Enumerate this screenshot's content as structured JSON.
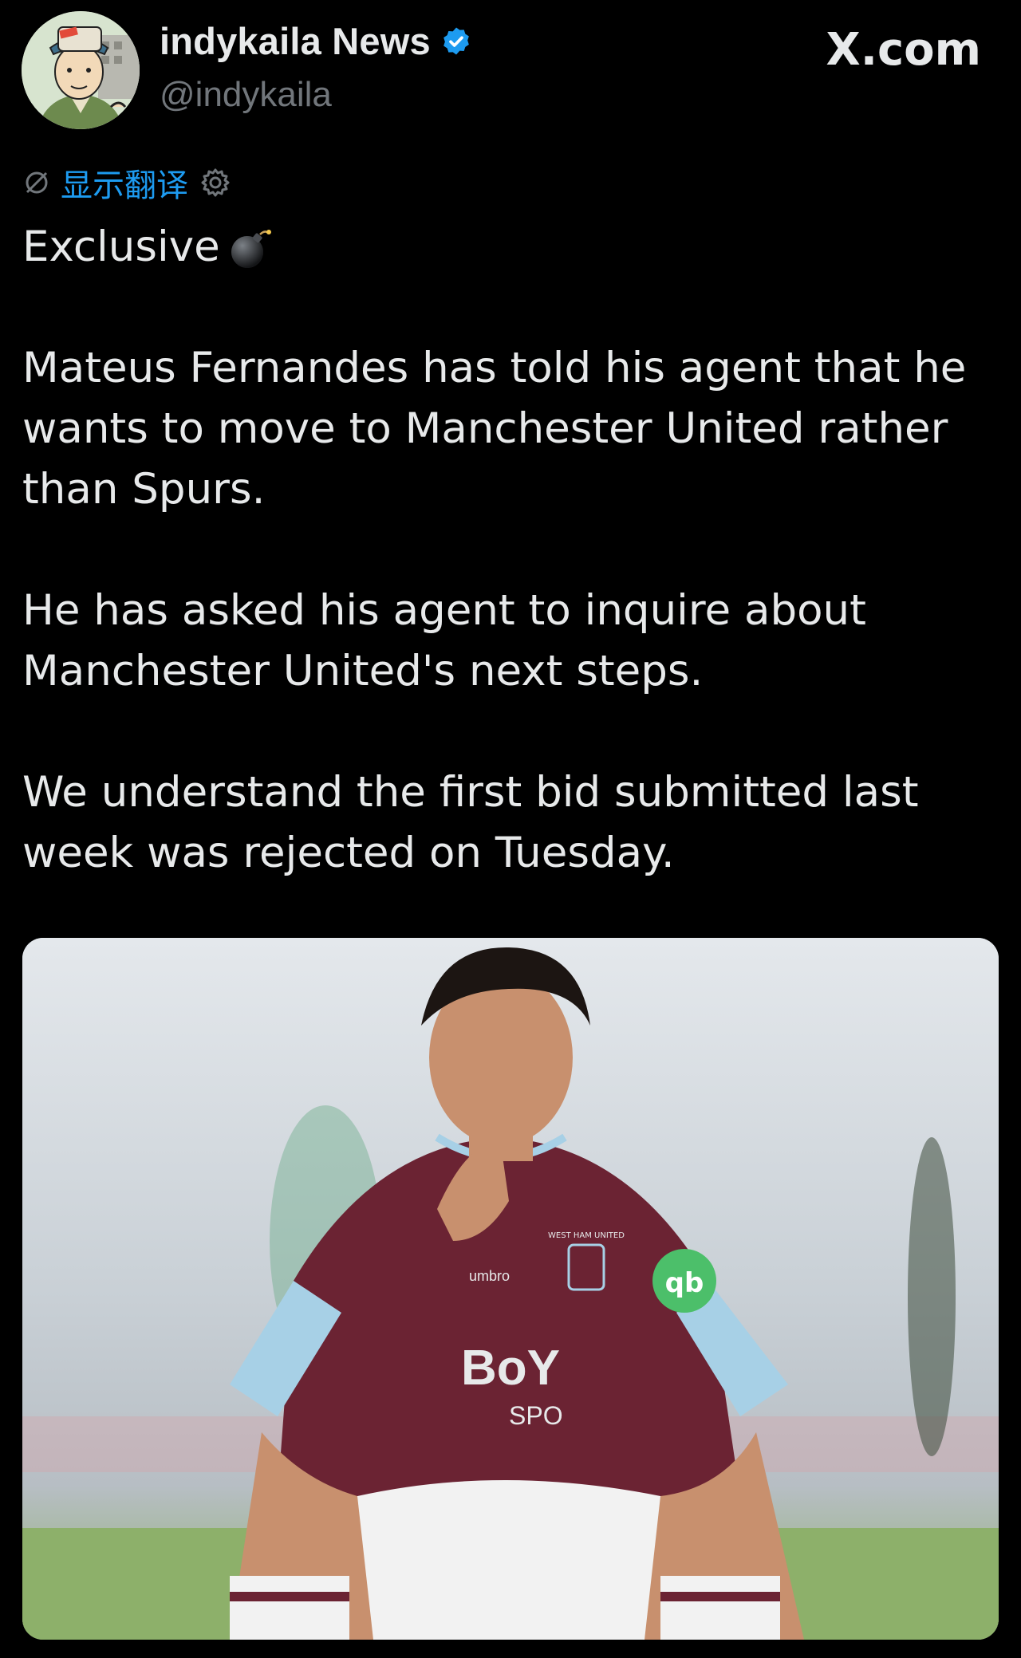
{
  "author": {
    "display_name": "indykaila News",
    "handle": "@indykaila",
    "verified": true,
    "verified_color": "#1d9bf0"
  },
  "site_brand": "X.com",
  "translate": {
    "label": "显示翻译",
    "icon_left": "slashed-globe-icon",
    "icon_right": "gear-icon"
  },
  "tweet": {
    "first_line": "Exclusive",
    "first_line_emoji": "bomb-emoji",
    "paragraphs": [
      "Mateus Fernandes has told his agent that he wants to move to Manchester United rather than Spurs.",
      "He has asked his agent to inquire about Manchester United's next steps.",
      "We understand the first bid submitted last week was rejected on Tuesday."
    ]
  },
  "media": {
    "kit_brand": "umbro",
    "sponsor_text": "BoY",
    "sponsor_sub": "SPO",
    "crest_text": "WEST HAM UNITED",
    "colors": {
      "shirt": "#6b2333",
      "sleeve": "#a7d0e6",
      "pitch": "#8db06a",
      "stand": "#c9d0d6"
    }
  },
  "colors": {
    "background": "#000000",
    "text_primary": "#e7e9ea",
    "text_secondary": "#71767b",
    "accent": "#1d9bf0"
  }
}
